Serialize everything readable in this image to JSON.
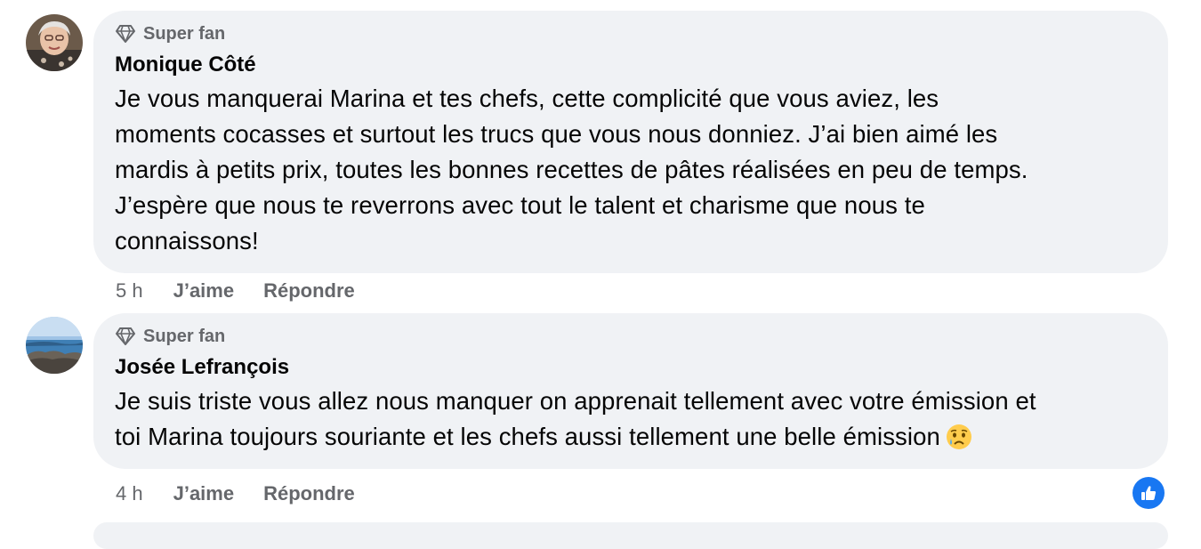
{
  "comments": [
    {
      "badge": "Super fan",
      "author": "Monique Côté",
      "text": "Je vous manquerai Marina et tes chefs, cette complicité que vous aviez, les\nmoments cocasses et surtout les trucs que vous nous donniez. J’ai bien aimé les\nmardis à petits prix, toutes les bonnes recettes de pâtes réalisées en peu de temps.\nJ’espère que nous te reverrons avec tout le talent et charisme que nous te\nconnaissons!",
      "time": "5 h",
      "like_label": "J’aime",
      "reply_label": "Répondre"
    },
    {
      "badge": "Super fan",
      "author": "Josée Lefrançois",
      "text": "Je suis triste vous allez nous manquer on apprenait tellement avec votre émission et\ntoi Marina toujours souriante et les chefs aussi tellement une belle émission",
      "emoji": "sad-but-relieved-face",
      "time": "4 h",
      "like_label": "J’aime",
      "reply_label": "Répondre",
      "reaction": "like-reaction-icon"
    }
  ],
  "colors": {
    "bubble": "#f0f2f5",
    "secondary_text": "#65676b",
    "primary_text": "#050505",
    "like_blue": "#1877f2"
  }
}
